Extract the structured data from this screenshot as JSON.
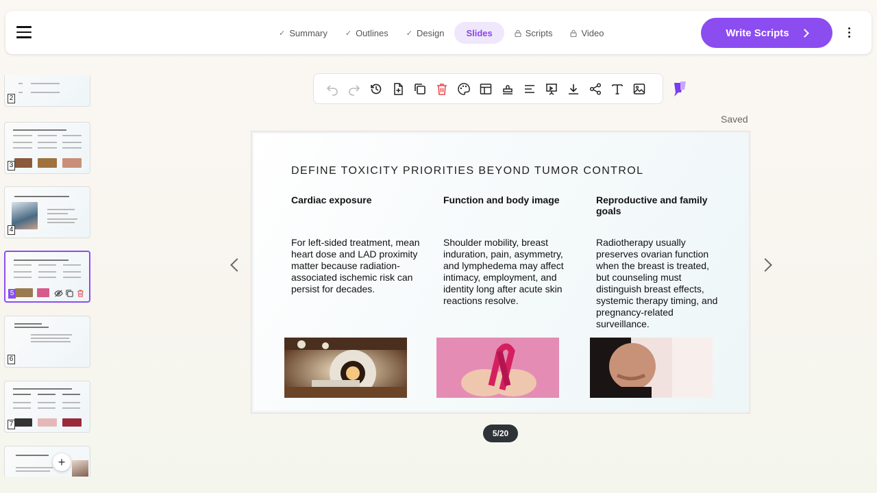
{
  "header": {
    "steps": [
      {
        "label": "Summary",
        "icon": "check-icon"
      },
      {
        "label": "Outlines",
        "icon": "check-icon"
      },
      {
        "label": "Design",
        "icon": "check-icon"
      },
      {
        "label": "Slides",
        "icon": ""
      },
      {
        "label": "Scripts",
        "icon": "lock-icon"
      },
      {
        "label": "Video",
        "icon": "lock-icon"
      }
    ],
    "cta_label": "Write Scripts"
  },
  "sidebar": {
    "thumbnails": [
      {
        "number": "2"
      },
      {
        "number": "3"
      },
      {
        "number": "4"
      },
      {
        "number": "5"
      },
      {
        "number": "6"
      },
      {
        "number": "7"
      }
    ]
  },
  "status": {
    "saved": "Saved"
  },
  "slide": {
    "title": "DEFINE TOXICITY PRIORITIES BEYOND TUMOR CONTROL",
    "columns": [
      {
        "heading": "Cardiac exposure",
        "body": "For left-sided treatment, mean heart dose and LAD proximity matter because radiation-associated ischemic risk can persist for decades."
      },
      {
        "heading": "Function and body image",
        "body": "Shoulder mobility, breast induration, pain, asymmetry, and lymphedema may affect intimacy, employment, and identity long after acute skin reactions resolve."
      },
      {
        "heading": "Reproductive and family goals",
        "body": "Radiotherapy usually preserves ovarian function when the breast is treated, but counseling must distinguish breast effects, systemic therapy timing, and pregnancy-related surveillance."
      }
    ]
  },
  "pager": {
    "label": "5/20"
  },
  "colors": {
    "accent": "#8b4cf0",
    "active_tab_bg": "#efe7fb",
    "delete": "#e5484d"
  }
}
